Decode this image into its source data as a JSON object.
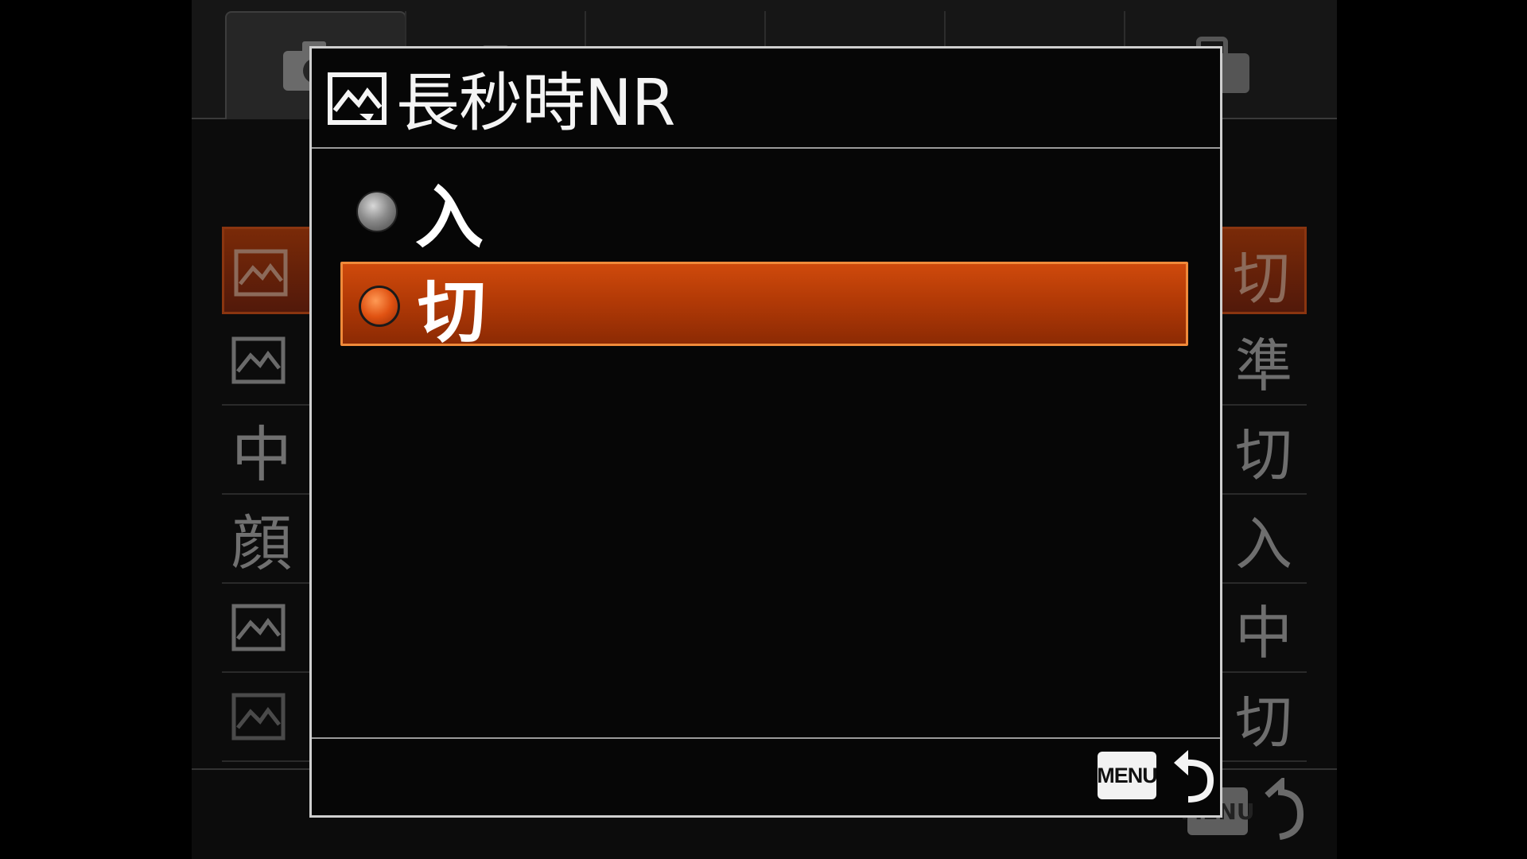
{
  "background_menu": {
    "rows": [
      {
        "label": "",
        "value": "切",
        "selected": true
      },
      {
        "label": "",
        "value": "準",
        "selected": false
      },
      {
        "label": "中",
        "value": "切",
        "selected": false
      },
      {
        "label": "顔",
        "value": "入",
        "selected": false
      },
      {
        "label": "",
        "value": "中",
        "selected": false
      },
      {
        "label": "",
        "value": "切",
        "selected": false
      }
    ],
    "menu_button_label": "MENU"
  },
  "dialog": {
    "title": "長秒時NR",
    "title_icon": "picture-effect-icon",
    "options": [
      {
        "label": "入",
        "selected": false
      },
      {
        "label": "切",
        "selected": true
      }
    ],
    "footer": {
      "menu_button_label": "MENU",
      "back_icon": "return-arrow-icon"
    }
  },
  "colors": {
    "accent": "#c2420a",
    "accent_border": "#f08a3a",
    "text": "#ffffff",
    "background": "#000000"
  }
}
